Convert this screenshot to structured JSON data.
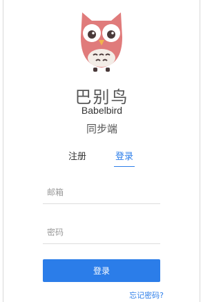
{
  "app": {
    "title_cn": "巴别鸟",
    "title_en": "Babelbird",
    "subtitle": "同步端",
    "brand_color": "#2b7de9",
    "logo_color": "#e07b7b",
    "logo_icon": "owl-logo-icon"
  },
  "tabs": [
    {
      "label": "注册",
      "active": false
    },
    {
      "label": "登录",
      "active": true
    }
  ],
  "form": {
    "email_placeholder": "邮箱",
    "email_value": "",
    "password_placeholder": "密码",
    "password_value": "",
    "submit_label": "登录",
    "forgot_label": "忘记密码?"
  }
}
